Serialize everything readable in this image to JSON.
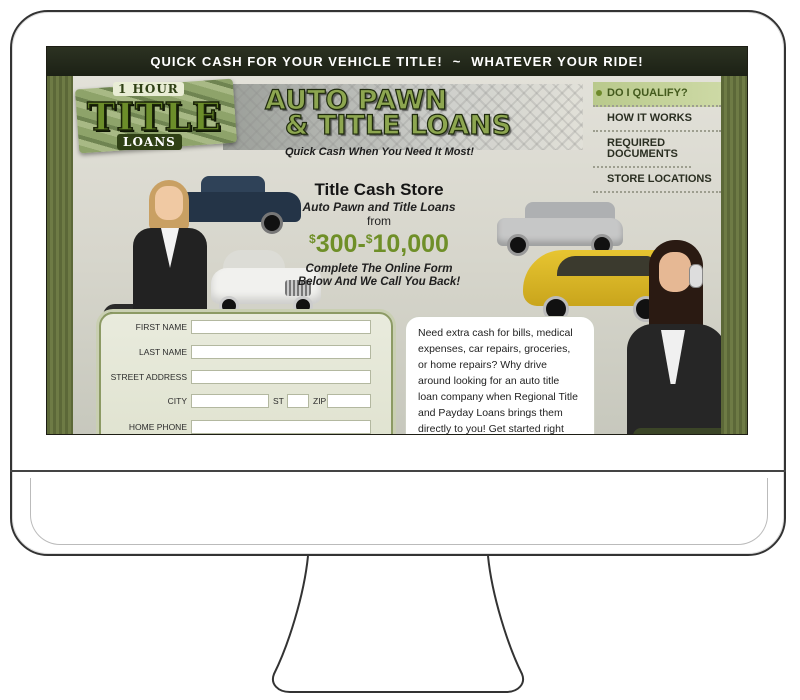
{
  "banner": {
    "left": "QUICK CASH FOR YOUR VEHICLE TITLE!",
    "separator": "~",
    "right": "WHATEVER YOUR RIDE!"
  },
  "logo": {
    "line1": "1 HOUR",
    "line2": "TITLE",
    "line3": "LOANS"
  },
  "headline": {
    "line1": "AUTO PAWN",
    "line2": "& TITLE LOANS",
    "tagline": "Quick Cash When You Need It Most!"
  },
  "nav": {
    "items": [
      {
        "label": "DO I QUALIFY?"
      },
      {
        "label": "HOW IT WORKS"
      },
      {
        "label": "REQUIRED DOCUMENTS"
      },
      {
        "label": "STORE LOCATIONS"
      }
    ]
  },
  "promo": {
    "title": "Title Cash Store",
    "subtitle": "Auto Pawn and Title Loans",
    "from": "from",
    "currency_symbol": "$",
    "min_amount": "300",
    "range_dash": "-",
    "max_amount": "10,000",
    "cta_line1": "Complete The Online Form",
    "cta_line2": "Below And We Call You Back!"
  },
  "form": {
    "first_name_label": "FIRST NAME",
    "last_name_label": "LAST NAME",
    "street_address_label": "STREET ADDRESS",
    "city_label": "CITY",
    "state_label": "ST",
    "zip_label": "ZIP",
    "home_phone_label": "HOME PHONE"
  },
  "info": {
    "text": "Need extra cash for bills, medical expenses, car repairs, groceries, or home repairs? Why drive around looking for an auto title loan company when Regional Title and Payday Loans brings them directly to you! Get started right now by"
  }
}
